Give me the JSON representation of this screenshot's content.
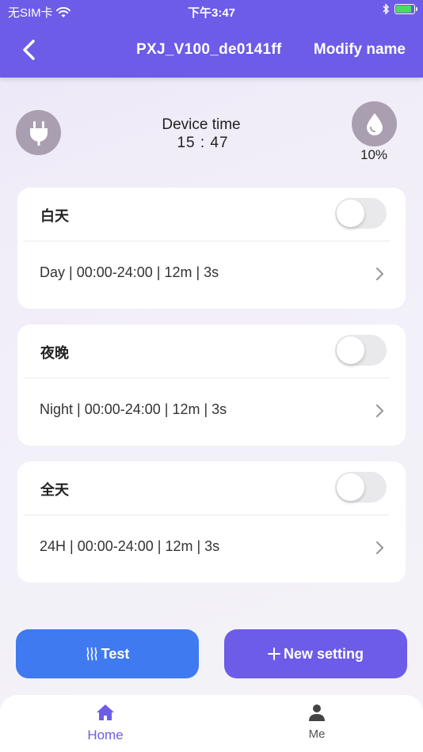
{
  "status_bar": {
    "carrier": "无SIM卡",
    "time": "下午3:47"
  },
  "header": {
    "device_name": "PXJ_V100_de0141ff",
    "modify_label": "Modify name",
    "back_icon": "chevron-left-icon"
  },
  "device": {
    "time_label": "Device time",
    "time_value": "15 : 47",
    "level_percent": "10%",
    "plug_icon": "plug-icon",
    "drop_icon": "water-drop-icon"
  },
  "schedules": [
    {
      "title": "白天",
      "detail": "Day | 00:00-24:00 | 12m | 3s",
      "enabled": false
    },
    {
      "title": "夜晚",
      "detail": "Night | 00:00-24:00 | 12m | 3s",
      "enabled": false
    },
    {
      "title": "全天",
      "detail": "24H | 00:00-24:00 | 12m | 3s",
      "enabled": false
    }
  ],
  "buttons": {
    "test_label": "Test",
    "new_setting_label": "New setting"
  },
  "tabs": [
    {
      "label": "Home",
      "icon": "home-icon",
      "active": true
    },
    {
      "label": "Me",
      "icon": "person-icon",
      "active": false
    }
  ],
  "colors": {
    "primary": "#6c5ce7",
    "test_button": "#3f7af0",
    "icon_circle": "#a99fb0"
  }
}
